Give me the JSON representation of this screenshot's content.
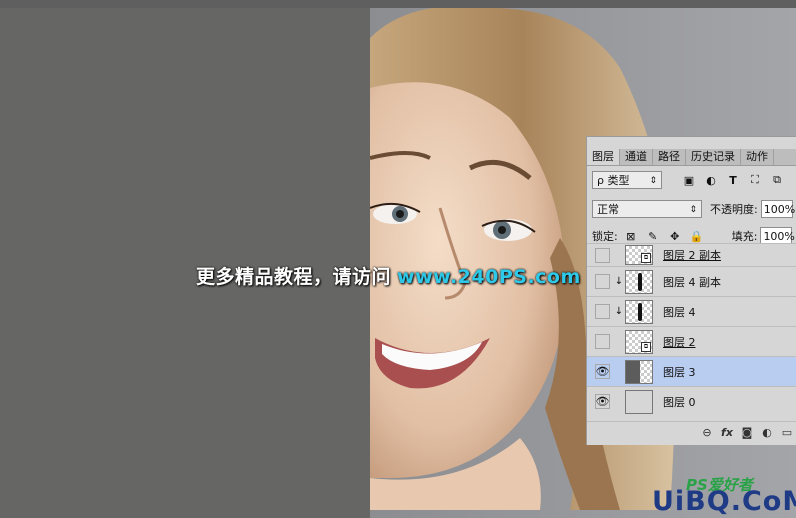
{
  "watermark": {
    "text": "更多精品教程，请访问",
    "site": "www.240PS.com"
  },
  "brand": {
    "cn": "PS爱好者",
    "en": "UiBQ.CoM"
  },
  "panel": {
    "tabs": [
      "图层",
      "通道",
      "路径",
      "历史记录",
      "动作"
    ],
    "filter": {
      "label": "ρ 类型",
      "arrow": "⇕"
    },
    "blend_mode": "正常",
    "opacity": {
      "label": "不透明度:",
      "value": "100%"
    },
    "lock": {
      "label": "锁定:"
    },
    "fill": {
      "label": "填充:",
      "value": "100%"
    },
    "layers": [
      {
        "name": "图层 2 副本",
        "visible": false,
        "selected": false
      },
      {
        "name": "图层 4 副本",
        "visible": false,
        "selected": false
      },
      {
        "name": "图层 4",
        "visible": false,
        "selected": false
      },
      {
        "name": "图层 2",
        "visible": false,
        "selected": false
      },
      {
        "name": "图层 3",
        "visible": true,
        "selected": true
      },
      {
        "name": "图层 0",
        "visible": true,
        "selected": false
      }
    ]
  },
  "icons": {
    "eye": "eye-icon",
    "link": "link-icon",
    "fx": "fx-icon",
    "mask": "mask-icon",
    "adjustment": "adjustment-icon",
    "folder": "folder-icon"
  },
  "colors": {
    "selected_layer": "#b9cdf1",
    "watermark_site": "#2ec8e8",
    "brand_blue": "#1f3b86"
  }
}
